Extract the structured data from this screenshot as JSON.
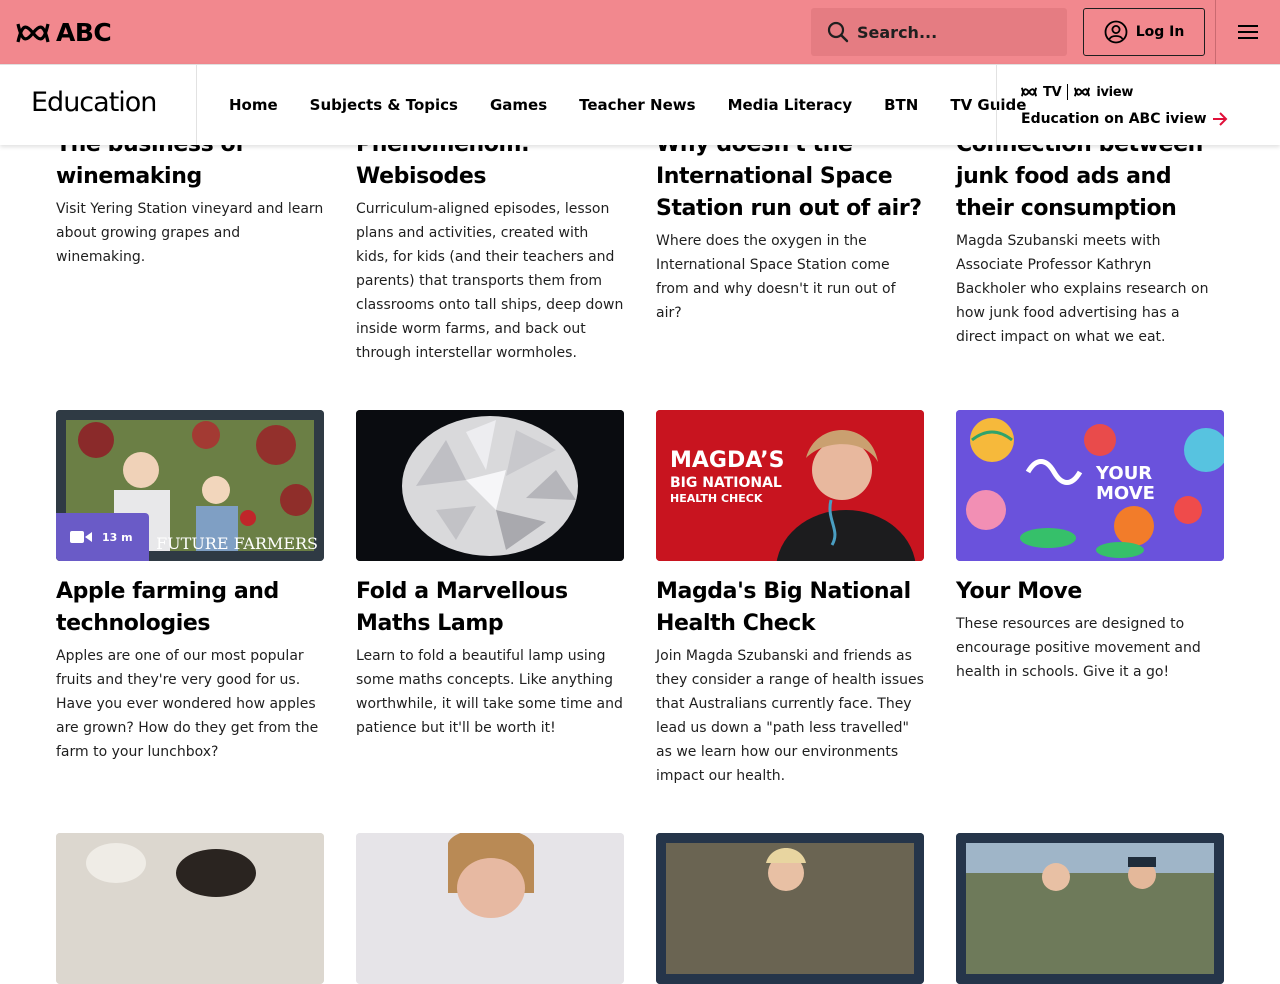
{
  "header": {
    "logo_text": "ABC",
    "search_placeholder": "Search...",
    "login_label": "Log In",
    "bg_color": "#f2888e"
  },
  "subnav": {
    "brand": "Education",
    "links": [
      "Home",
      "Subjects & Topics",
      "Games",
      "Teacher News",
      "Media Literacy",
      "BTN",
      "TV Guide"
    ],
    "iview_logo_tv": "TV",
    "iview_logo_iview": "iview",
    "iview_cta": "Education on ABC iview"
  },
  "top_cards": [
    {
      "title": "The business of winemaking",
      "desc": "Visit Yering Station vineyard and learn about growing grapes and winemaking."
    },
    {
      "title": "Phenomenom: Webisodes",
      "desc": "Curriculum-aligned episodes, lesson plans and activities, created with kids, for kids (and their teachers and parents) that transports them from classrooms onto tall ships, deep down inside worm farms, and back out through interstellar wormholes."
    },
    {
      "title": "Why doesn't the International Space Station run out of air?",
      "desc": "Where does the oxygen in the International Space Station come from and why doesn't it run out of air?"
    },
    {
      "title": "Connection between junk food ads and their consumption",
      "desc": "Magda Szubanski meets with Associate Professor Kathryn Backholer who explains research on how junk food advertising has a direct impact on what we eat."
    }
  ],
  "mid_cards": [
    {
      "title": "Apple farming and technologies",
      "desc": "Apples are one of our most popular fruits and they're very good for us. Have you ever wondered how apples are grown? How do they get from the farm to your lunchbox?",
      "badge": "13 m",
      "thumb_caption": "FUTURE FARMERS"
    },
    {
      "title": "Fold a Marvellous Maths Lamp",
      "desc": "Learn to fold a beautiful lamp using some maths concepts. Like anything worthwhile, it will take some time and patience but it'll be worth it!"
    },
    {
      "title": "Magda's Big National Health Check",
      "desc": "Join Magda Szubanski and friends as they consider a range of health issues that Australians currently face. They lead us down a \"path less travelled\" as we learn how our environments impact our health.",
      "thumb_line1": "MAGDA’S",
      "thumb_line2": "BIG NATIONAL",
      "thumb_line3": "HEALTH CHECK"
    },
    {
      "title": "Your Move",
      "desc": "These resources are designed to encourage positive movement and health in schools. Give it a go!",
      "thumb_line1": "YOUR",
      "thumb_line2": "MOVE"
    }
  ]
}
